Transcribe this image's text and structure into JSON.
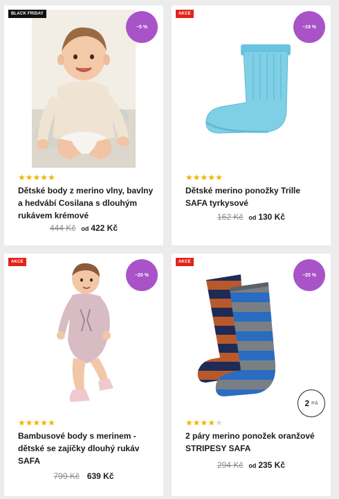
{
  "products": [
    {
      "badge": "BLACK FRIDAY",
      "discount": "−5 %",
      "rating": 5,
      "title": "Dětské body z merino vlny, bavlny a hedvábí Cosilana s dlouhým rukávem krémové",
      "old_price": "444 Kč",
      "from_label": "od",
      "price": "422 Kč",
      "image": "baby-in-cream-bodysuit"
    },
    {
      "badge": "AKCE",
      "discount": "−19 %",
      "rating": 5,
      "title": "Dětské merino ponožky Trille SAFA tyrkysové",
      "old_price": "162 Kč",
      "from_label": "od",
      "price": "130 Kč",
      "image": "turquoise-sock"
    },
    {
      "badge": "AKCE",
      "discount": "−20 %",
      "rating": 5,
      "title": "Bambusové body s merinem - dětské se zajíčky dlouhý rukáv SAFA",
      "old_price": "799 Kč",
      "from_label": "",
      "price": "639 Kč",
      "image": "baby-in-pink-bodysuit"
    },
    {
      "badge": "AKCE",
      "discount": "−20 %",
      "rating": 4,
      "title": "2 páry merino ponožek oranžové STRIPESY SAFA",
      "old_price": "294 Kč",
      "from_label": "od",
      "price": "235 Kč",
      "image": "striped-socks-pair"
    }
  ],
  "pager": {
    "count": "2",
    "unit": "PÁ"
  },
  "colors": {
    "discount_bubble": "#a854c8",
    "akce_badge": "#e2231a",
    "black_friday_badge": "#111111",
    "star": "#f2b400"
  }
}
